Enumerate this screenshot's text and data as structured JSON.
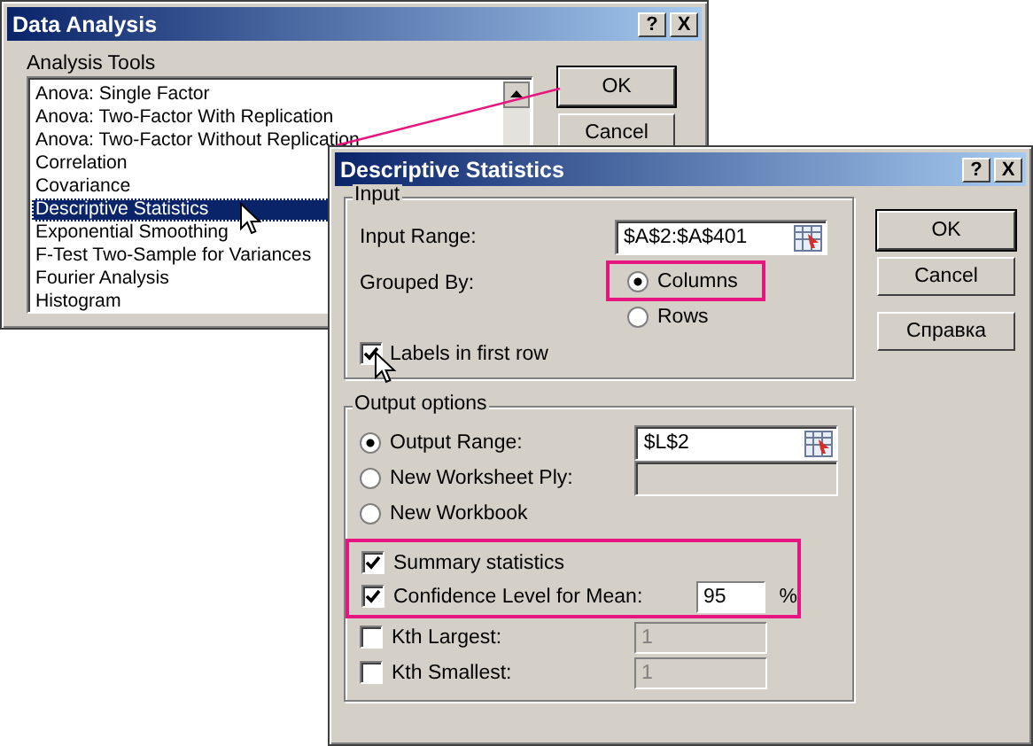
{
  "data_analysis": {
    "title": "Data Analysis",
    "help_button": "?",
    "close_button": "X",
    "list_label": "Analysis Tools",
    "tools": [
      {
        "label": "Anova: Single Factor",
        "selected": false
      },
      {
        "label": "Anova: Two-Factor With Replication",
        "selected": false
      },
      {
        "label": "Anova: Two-Factor Without Replication",
        "selected": false
      },
      {
        "label": "Correlation",
        "selected": false
      },
      {
        "label": "Covariance",
        "selected": false
      },
      {
        "label": "Descriptive Statistics",
        "selected": true
      },
      {
        "label": "Exponential Smoothing",
        "selected": false
      },
      {
        "label": "F-Test Two-Sample for Variances",
        "selected": false
      },
      {
        "label": "Fourier Analysis",
        "selected": false
      },
      {
        "label": "Histogram",
        "selected": false
      }
    ],
    "buttons": [
      "OK",
      "Cancel"
    ]
  },
  "descriptive_statistics": {
    "title": "Descriptive Statistics",
    "help_button": "?",
    "close_button": "X",
    "input": {
      "group_label": "Input",
      "range_label": "Input Range:",
      "range_value": "$A$2:$A$401",
      "grouped_by_label": "Grouped By:",
      "grouped_by": [
        {
          "label": "Columns",
          "selected": true,
          "highlighted": true
        },
        {
          "label": "Rows",
          "selected": false,
          "highlighted": false
        }
      ],
      "labels_in_first_row": {
        "label": "Labels in first row",
        "checked": true
      }
    },
    "output": {
      "group_label": "Output options",
      "destinations": [
        {
          "label": "Output Range:",
          "selected": true,
          "kind": "range",
          "value": "$L$2"
        },
        {
          "label": "New Worksheet Ply:",
          "selected": false,
          "kind": "text"
        },
        {
          "label": "New Workbook",
          "selected": false,
          "kind": "none"
        }
      ],
      "highlighted_checks": [
        {
          "label": "Summary statistics",
          "checked": true,
          "kind": "plain"
        },
        {
          "label": "Confidence Level for Mean:",
          "checked": true,
          "kind": "value",
          "value": "95",
          "unit": "%"
        }
      ],
      "other_checks": [
        {
          "label": "Kth Largest:",
          "checked": false,
          "kind": "value",
          "value": "1"
        },
        {
          "label": "Kth Smallest:",
          "checked": false,
          "kind": "value",
          "value": "1"
        }
      ]
    },
    "buttons": [
      "OK",
      "Cancel",
      "Справка"
    ]
  }
}
